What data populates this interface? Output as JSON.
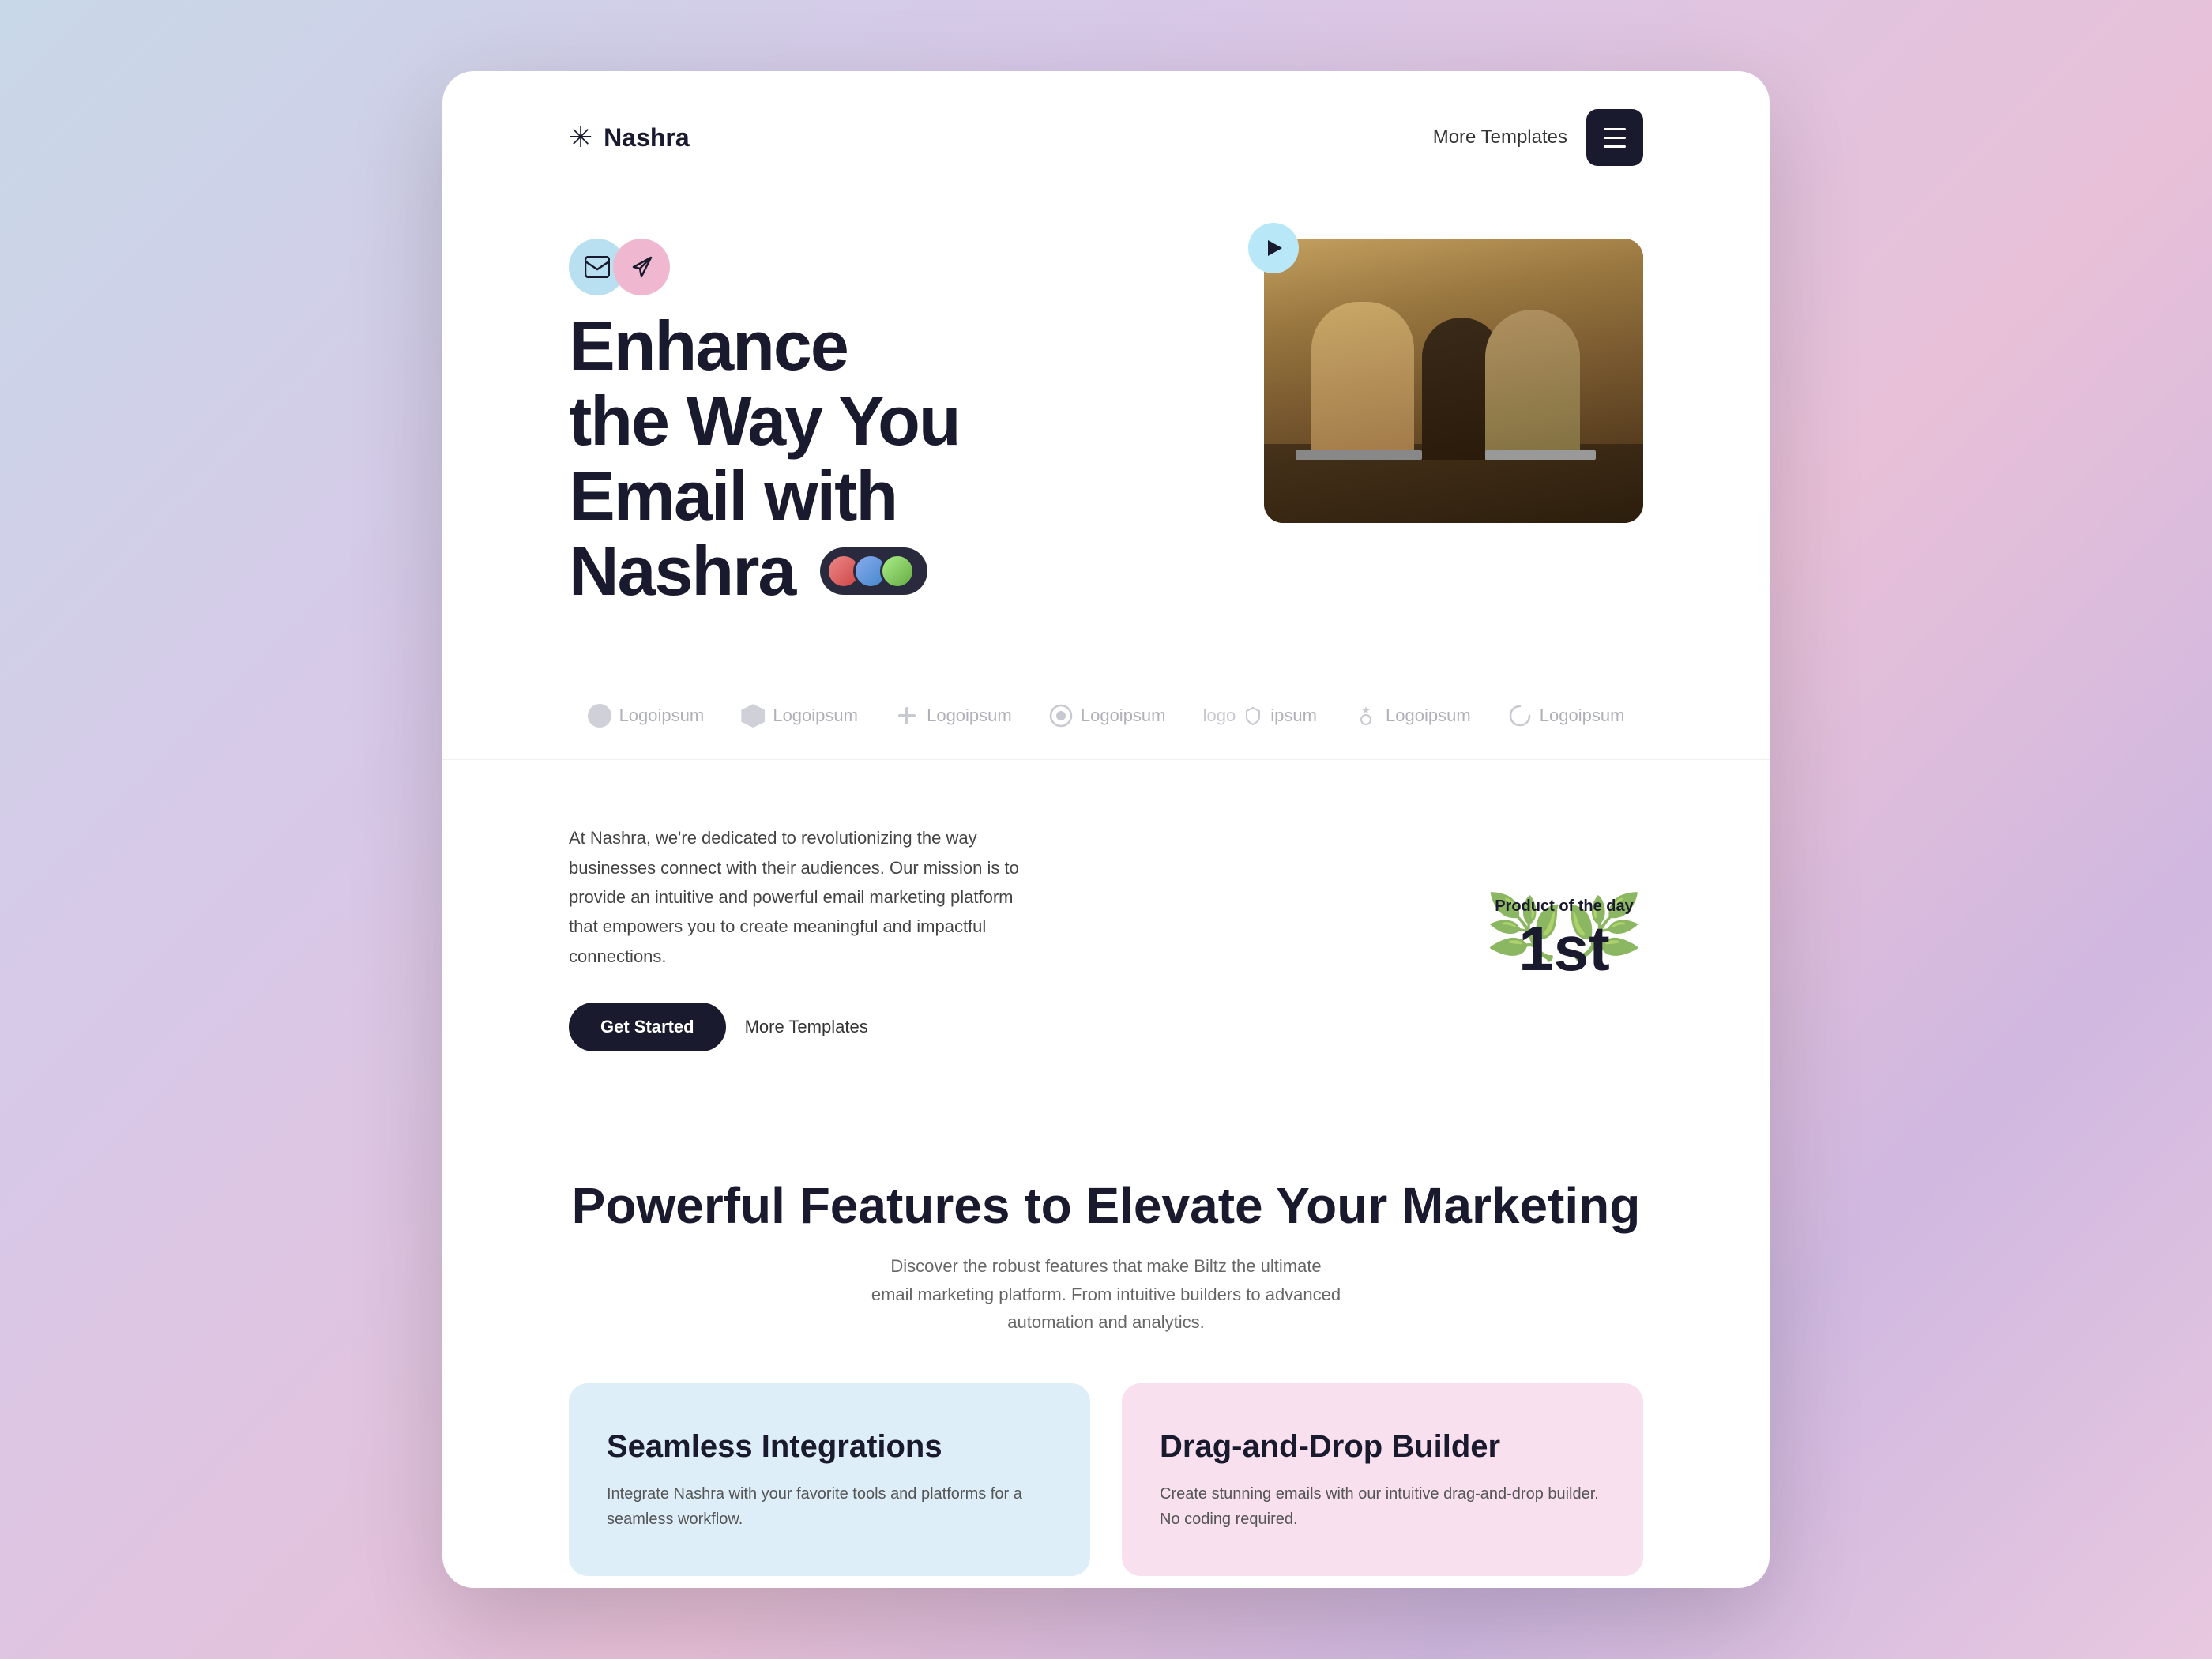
{
  "navbar": {
    "logo_symbol": "✳",
    "logo_name": "Nashra",
    "more_templates": "More Templates"
  },
  "hero": {
    "title_parts": [
      "Enhance",
      "the Way You",
      "Email with",
      "Nashra"
    ],
    "icons": [
      "✉",
      "◁"
    ],
    "play_label": "Play video"
  },
  "logos": [
    {
      "icon": "circle",
      "text": "Logoipsum"
    },
    {
      "icon": "shield",
      "text": "Logoipsum"
    },
    {
      "icon": "plus",
      "text": "Logoipsum"
    },
    {
      "icon": "circle",
      "text": "Logoipsum"
    },
    {
      "icon": "shield-small",
      "text": "logo ipsum"
    },
    {
      "icon": "lightning",
      "text": "Logoipsum"
    },
    {
      "icon": "circle2",
      "text": "Logoipsum"
    }
  ],
  "about": {
    "text": "At Nashra, we're dedicated to revolutionizing the way businesses connect with their audiences. Our mission is to provide an intuitive and powerful email marketing platform that empowers you to create meaningful and impactful connections.",
    "btn_primary": "Get Started",
    "btn_link": "More Templates",
    "badge_label": "Product of the day",
    "badge_rank": "1st"
  },
  "features": {
    "title": "Powerful Features to Elevate Your Marketing",
    "subtitle": "Discover the robust features that make Biltz the ultimate email marketing platform. From intuitive builders to advanced automation and analytics.",
    "cards": [
      {
        "title": "Seamless Integrations",
        "text": "Integrate Nashra with your favorite tools and platforms for a seamless workflow.",
        "color": "blue"
      },
      {
        "title": "Drag-and-Drop Builder",
        "text": "Create stunning emails with our intuitive drag-and-drop builder. No coding required.",
        "color": "pink"
      }
    ]
  }
}
